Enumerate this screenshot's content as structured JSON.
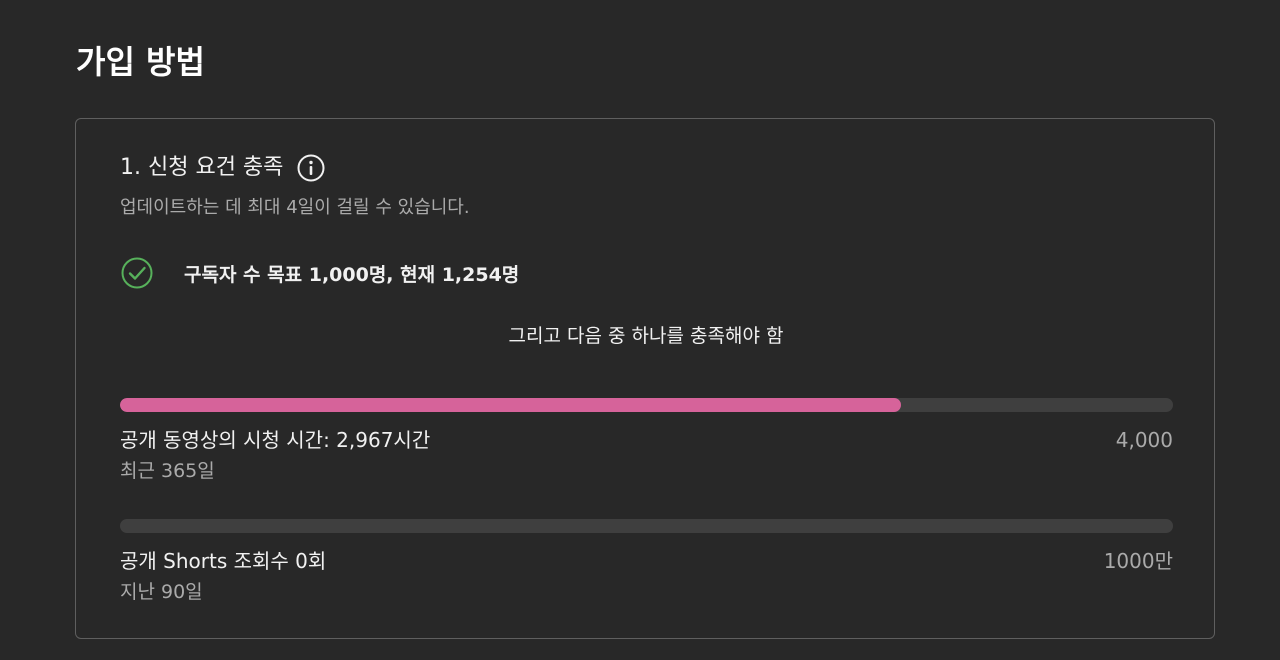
{
  "page": {
    "title": "가입 방법"
  },
  "requirements": {
    "title": "1. 신청 요건 충족",
    "info_icon": "info-icon",
    "subtitle": "업데이트하는 데 최대 4일이 걸릴 수 있습니다.",
    "subscriber": {
      "icon": "check-circle-icon",
      "text": "구독자 수 목표 1,000명, 현재 1,254명"
    },
    "or_text": "그리고 다음 중 하나를 충족해야 함",
    "watch_hours": {
      "label": "공개 동영상의 시청 시간: 2,967시간",
      "period": "최근 365일",
      "goal": "4,000",
      "progress": 0.742
    },
    "shorts_views": {
      "label": "공개 Shorts 조회수 0회",
      "period": "지난 90일",
      "goal": "1000만",
      "progress": 0
    }
  },
  "colors": {
    "background": "#282828",
    "accent_fill": "#d6639a",
    "track": "#3f3f3f",
    "check": "#57b15b"
  }
}
